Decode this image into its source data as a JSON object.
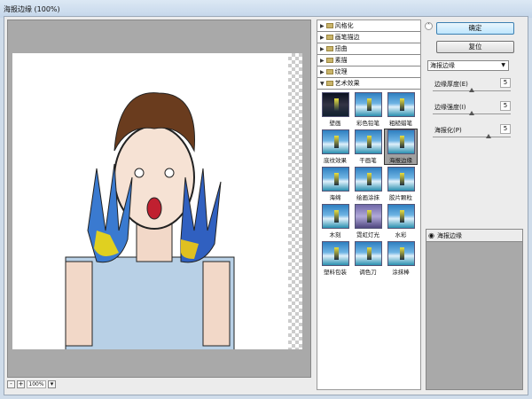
{
  "window": {
    "title": "海报边缘 (100%)"
  },
  "preview": {
    "zoom": "100%",
    "zoom_out": "-",
    "zoom_in": "+"
  },
  "filter_categories": [
    {
      "label": "风格化",
      "expanded": false
    },
    {
      "label": "画笔描边",
      "expanded": false
    },
    {
      "label": "扭曲",
      "expanded": false
    },
    {
      "label": "素描",
      "expanded": false
    },
    {
      "label": "纹理",
      "expanded": false
    },
    {
      "label": "艺术效果",
      "expanded": true
    }
  ],
  "artistic_filters": [
    {
      "label": "壁画"
    },
    {
      "label": "彩色铅笔"
    },
    {
      "label": "粗糙蜡笔"
    },
    {
      "label": "底纹效果"
    },
    {
      "label": "干画笔"
    },
    {
      "label": "海报边缘",
      "selected": true
    },
    {
      "label": "海绵"
    },
    {
      "label": "绘画涂抹"
    },
    {
      "label": "胶片颗粒"
    },
    {
      "label": "木刻"
    },
    {
      "label": "霓虹灯光"
    },
    {
      "label": "水彩"
    },
    {
      "label": "塑料包装"
    },
    {
      "label": "调色刀"
    },
    {
      "label": "涂抹棒"
    }
  ],
  "buttons": {
    "ok": "确定",
    "reset": "复位"
  },
  "filter_select": {
    "value": "海报边缘"
  },
  "params": [
    {
      "label": "边缘厚度(E)",
      "value": "5",
      "slider_fraction": 0.5
    },
    {
      "label": "边缘强度(I)",
      "value": "5",
      "slider_fraction": 0.5
    },
    {
      "label": "海报化(P)",
      "value": "5",
      "slider_fraction": 0.72
    }
  ],
  "layers": [
    {
      "label": "海报边缘",
      "visible": true
    }
  ]
}
